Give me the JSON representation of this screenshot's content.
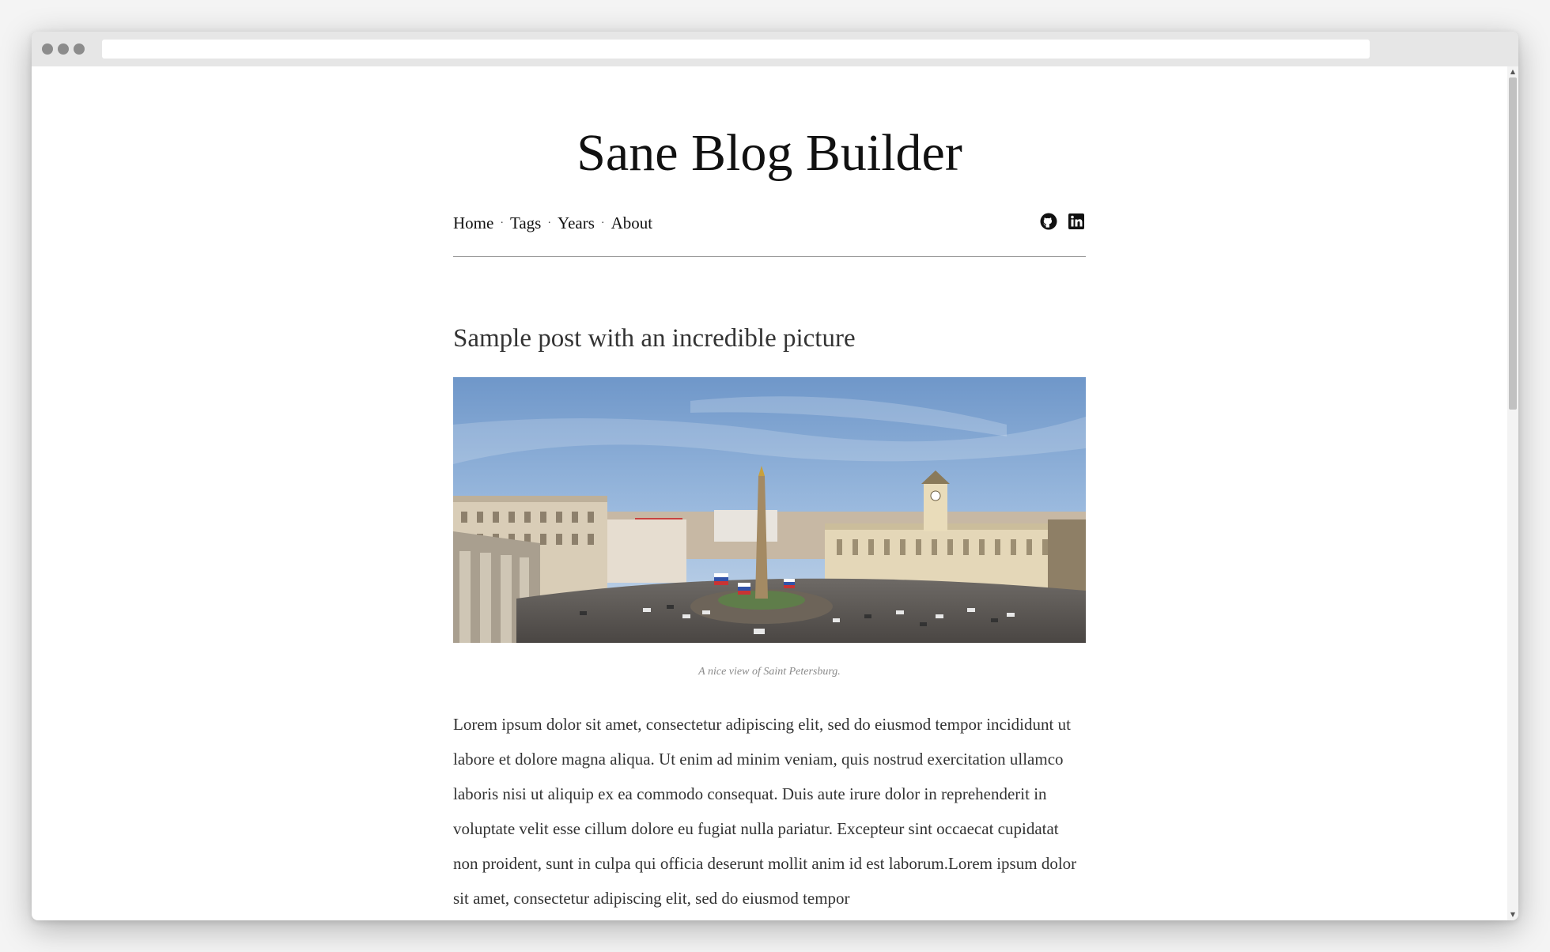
{
  "browser": {
    "url": ""
  },
  "site": {
    "title": "Sane Blog Builder"
  },
  "nav": {
    "items": [
      {
        "label": "Home"
      },
      {
        "label": "Tags"
      },
      {
        "label": "Years"
      },
      {
        "label": "About"
      }
    ],
    "separator": "·"
  },
  "social": {
    "icons": [
      "github-icon",
      "linkedin-icon"
    ]
  },
  "post": {
    "title": "Sample post with an incredible picture",
    "image_caption": "A nice view of Saint Petersburg.",
    "body": "Lorem ipsum dolor sit amet, consectetur adipiscing elit, sed do eiusmod tempor incididunt ut labore et dolore magna aliqua. Ut enim ad minim veniam, quis nostrud exercitation ullamco laboris nisi ut aliquip ex ea commodo consequat. Duis aute irure dolor in reprehenderit in voluptate velit esse cillum dolore eu fugiat nulla pariatur. Excepteur sint occaecat cupidatat non proident, sunt in culpa qui officia deserunt mollit anim id est laborum.Lorem ipsum dolor sit amet, consectetur adipiscing elit, sed do eiusmod tempor"
  },
  "colors": {
    "title_text": "#111111",
    "body_text": "#333333",
    "caption_text": "#8a8a8a",
    "rule": "#999999"
  }
}
